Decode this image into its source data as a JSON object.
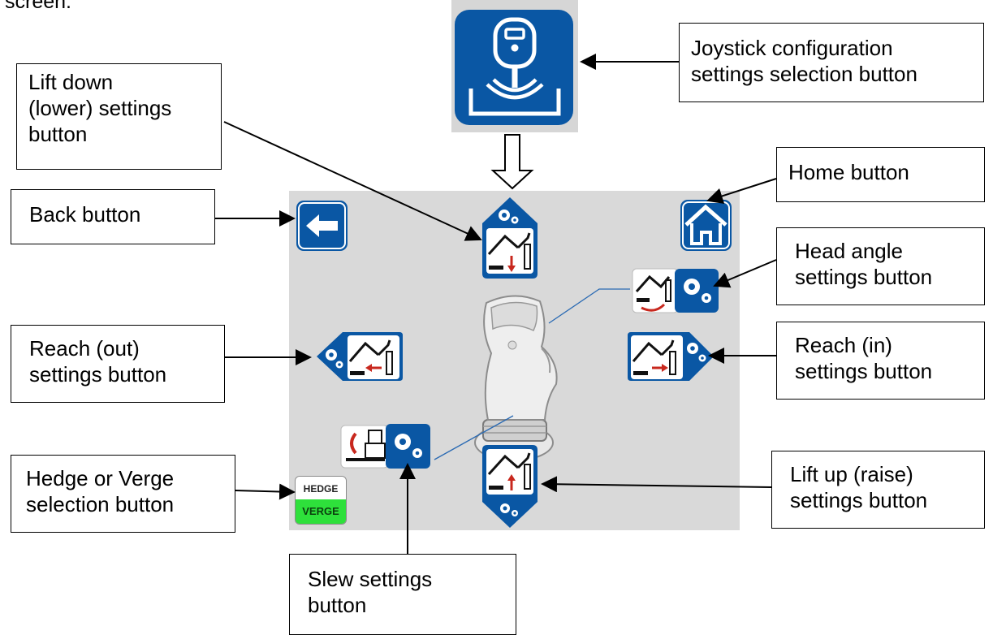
{
  "page_intro_fragment": "screen.",
  "callouts": {
    "joystick": "Joystick configuration\nsettings selection button",
    "lift_down": "Lift down\n(lower) settings\nbutton",
    "home": "Home button",
    "back": "Back button",
    "head_angle": "Head angle\nsettings button",
    "reach_out": "Reach (out)\nsettings button",
    "reach_in": "Reach (in)\nsettings button",
    "hedge_verge": "Hedge or Verge\nselection button",
    "lift_up": "Lift up (raise)\nsettings button",
    "slew": "Slew settings\nbutton"
  },
  "hedge_verge_button": {
    "top_label": "HEDGE",
    "bottom_label": "VERGE"
  },
  "colors": {
    "brand_blue": "#0a57a4",
    "screen_bg": "#d9d9d9",
    "verge_green": "#2ee03b",
    "arrow_red": "#c8281e"
  },
  "icons": [
    "joystick-icon",
    "back-arrow-icon",
    "home-icon",
    "gear-icon",
    "hedge-cutter-arm-icon",
    "joystick-handle-image"
  ]
}
